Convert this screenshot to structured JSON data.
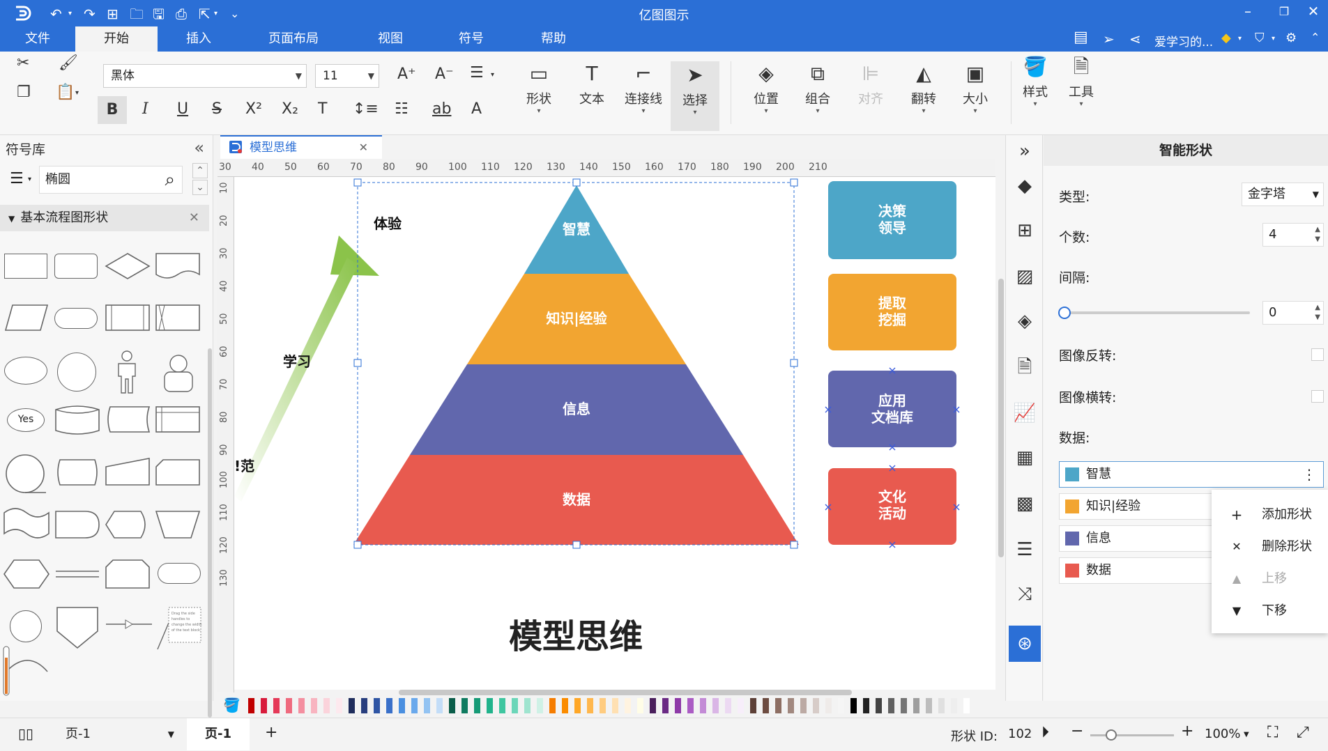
{
  "app": {
    "title": "亿图图示",
    "colors": {
      "brand": "#2b6fd6"
    }
  },
  "menubar": {
    "tabs": [
      "文件",
      "开始",
      "插入",
      "页面布局",
      "视图",
      "符号",
      "帮助"
    ],
    "active_tab": "开始",
    "user_label": "爱学习的..."
  },
  "ribbon": {
    "font_family": "黑体",
    "font_size": "11",
    "buttons": {
      "shape": "形状",
      "text": "文本",
      "connector": "连接线",
      "select": "选择",
      "position": "位置",
      "group": "组合",
      "align": "对齐",
      "flip": "翻转",
      "size": "大小",
      "style": "样式",
      "tools": "工具"
    },
    "format_glyphs": {
      "bold": "B",
      "italic": "I",
      "underline": "U",
      "strike": "S",
      "superscript": "X²",
      "subscript": "X₂",
      "font_case": "T",
      "font_underline_ab": "ab",
      "font_color": "A"
    }
  },
  "library": {
    "title": "符号库",
    "search_value": "椭圆",
    "category": "基本流程图形状",
    "shapes": {
      "yes_label": "Yes",
      "note_text": "Drag the side handles to change the width of the text block."
    }
  },
  "document": {
    "tab_title": "模型思维",
    "ruler_h": [
      "30",
      "40",
      "50",
      "60",
      "70",
      "80",
      "90",
      "100",
      "110",
      "120",
      "130",
      "140",
      "150",
      "160",
      "170",
      "180",
      "190",
      "200",
      "210"
    ],
    "ruler_v": [
      "10",
      "20",
      "30",
      "40",
      "50",
      "60",
      "70",
      "80",
      "90",
      "100",
      "110",
      "120",
      "130"
    ]
  },
  "diagram": {
    "pyramid_levels": [
      {
        "label": "智慧",
        "color": "#4da6c8"
      },
      {
        "label": "知识|经验",
        "color": "#f2a531"
      },
      {
        "label": "信息",
        "color": "#6167ad"
      },
      {
        "label": "数据",
        "color": "#e85a4f"
      }
    ],
    "side_boxes": [
      {
        "lines": [
          "决策",
          "领导"
        ],
        "color": "#4da6c8"
      },
      {
        "lines": [
          "提取",
          "挖掘"
        ],
        "color": "#f2a531"
      },
      {
        "lines": [
          "应用",
          "文档库"
        ],
        "color": "#6167ad"
      },
      {
        "lines": [
          "文化",
          "活动"
        ],
        "color": "#e85a4f"
      }
    ],
    "arrow_labels": {
      "top": "体验",
      "middle": "学习",
      "bottom": "!范"
    },
    "caption": "模型思维"
  },
  "props": {
    "header": "智能形状",
    "type_label": "类型:",
    "type_value": "金字塔",
    "count_label": "个数:",
    "count_value": "4",
    "spacing_label": "间隔:",
    "spacing_value": "0",
    "spacing_slider_fraction": 0,
    "flip_label": "图像反转:",
    "mirror_label": "图像横转:",
    "data_label": "数据:",
    "data_rows": [
      {
        "label": "智慧",
        "color": "#4da6c8"
      },
      {
        "label": "知识|经验",
        "color": "#f2a531"
      },
      {
        "label": "信息",
        "color": "#6167ad"
      },
      {
        "label": "数据",
        "color": "#e85a4f"
      }
    ],
    "context_menu": [
      {
        "label": "添加形状",
        "icon": "plus-icon",
        "glyph": "+",
        "disabled": false
      },
      {
        "label": "删除形状",
        "icon": "close-icon",
        "glyph": "✕",
        "disabled": false
      },
      {
        "label": "上移",
        "icon": "triangle-up-icon",
        "glyph": "▲",
        "disabled": true
      },
      {
        "label": "下移",
        "icon": "triangle-down-icon",
        "glyph": "▼",
        "disabled": false
      }
    ]
  },
  "statusbar": {
    "page_select": "页-1",
    "page_tab": "页-1",
    "add_page": "+",
    "shape_id_label": "形状 ID:",
    "shape_id_value": "102",
    "zoom": "100%",
    "zoom_slider_fraction": 0.25
  }
}
